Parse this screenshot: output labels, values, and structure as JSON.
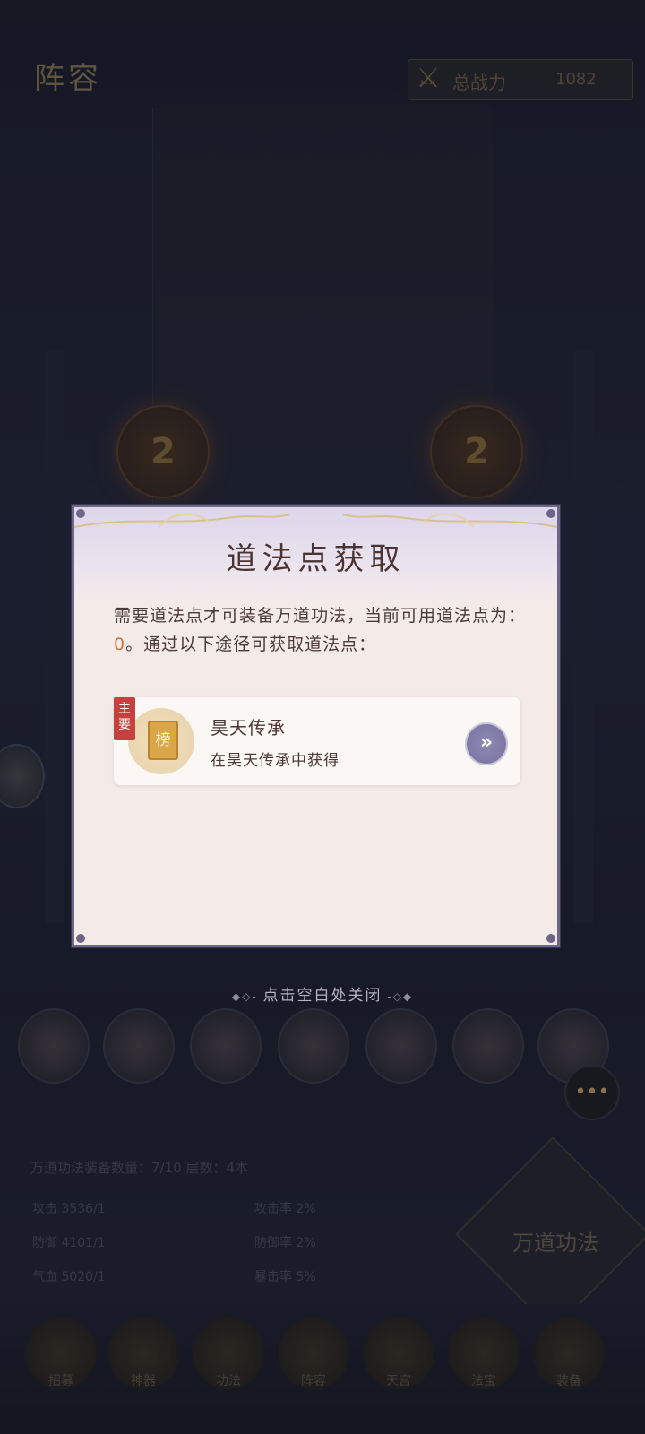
{
  "background": {
    "page_title": "阵容",
    "power_label": "总战力",
    "power_value": "1082",
    "info_title": "万道功法装备数量：7/10 层数：4本",
    "info_stats": [
      "攻击 3536/1",
      "防御 4101/1",
      "气血 5020/1",
      "攻击率 2%",
      "防御率 2%",
      "暴击率 5%"
    ],
    "gate_label": "万道功法",
    "nav_labels": [
      "招募",
      "神器",
      "功法",
      "阵容",
      "天宫",
      "法宝",
      "装备"
    ]
  },
  "dialog": {
    "title": "道法点获取",
    "desc_before": "需要道法点才可装备万道功法，当前可用道法点为：",
    "points": "0",
    "desc_after": "。通过以下途径可获取道法点：",
    "route": {
      "tag": "主要",
      "icon_text": "榜",
      "name": "昊天传承",
      "subtitle": "在昊天传承中获得"
    }
  },
  "close_hint": "点击空白处关闭",
  "icons": {
    "crossed-swords": "⚔",
    "go": "»",
    "chat": "•••"
  },
  "colors": {
    "dialog_bg": "#f4ebe9",
    "dialog_border": "#6d6687",
    "accent_number": "#c27a34",
    "tag_red": "#c6403e",
    "go_button": "#7772a0"
  }
}
